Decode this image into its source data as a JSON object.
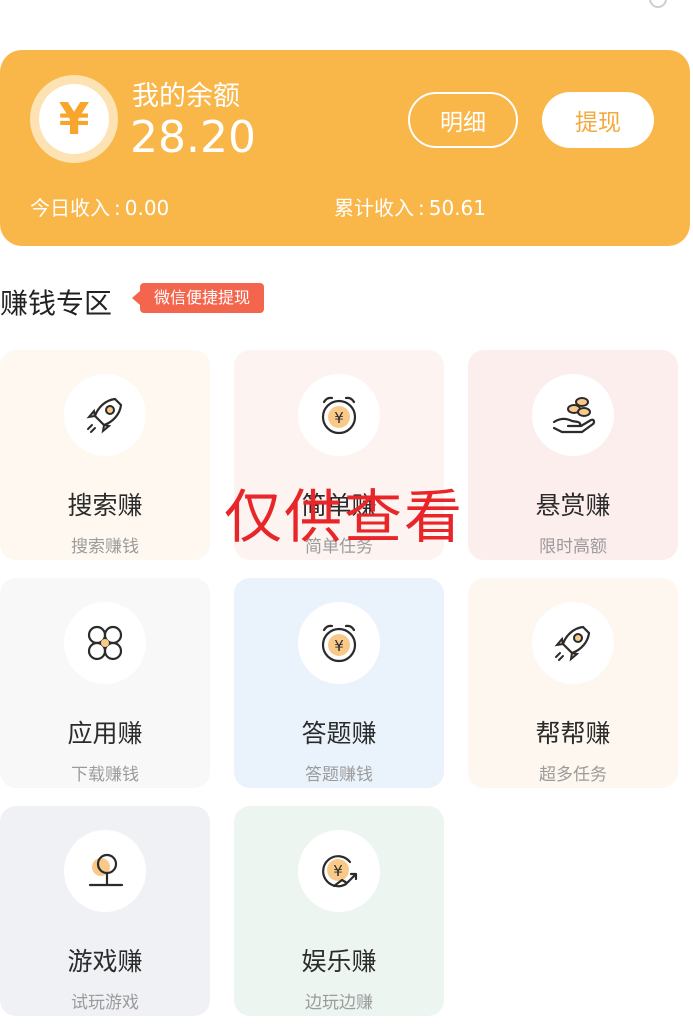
{
  "balance": {
    "label": "我的余额",
    "amount": "28.20",
    "yen_symbol": "¥",
    "detail_button": "明细",
    "withdraw_button": "提现",
    "today_label": "今日收入",
    "today_value": "0.00",
    "total_label": "累计收入",
    "total_value": "50.61"
  },
  "section": {
    "title": "赚钱专区",
    "tag": "微信便捷提现"
  },
  "cards": [
    {
      "title": "搜索赚",
      "subtitle": "搜索赚钱",
      "icon": "rocket-icon"
    },
    {
      "title": "简单赚",
      "subtitle": "简单任务",
      "icon": "alarm-coin-icon"
    },
    {
      "title": "悬赏赚",
      "subtitle": "限时高额",
      "icon": "hand-coins-icon"
    },
    {
      "title": "应用赚",
      "subtitle": "下载赚钱",
      "icon": "apps-icon"
    },
    {
      "title": "答题赚",
      "subtitle": "答题赚钱",
      "icon": "alarm-coin-icon"
    },
    {
      "title": "帮帮赚",
      "subtitle": "超多任务",
      "icon": "rocket-icon"
    },
    {
      "title": "游戏赚",
      "subtitle": "试玩游戏",
      "icon": "joystick-icon"
    },
    {
      "title": "娱乐赚",
      "subtitle": "边玩边赚",
      "icon": "coin-trend-icon"
    }
  ],
  "watermark": "仅供查看",
  "colors": {
    "accent": "#f9b649",
    "tag": "#f4654d",
    "watermark": "#e8262a"
  }
}
